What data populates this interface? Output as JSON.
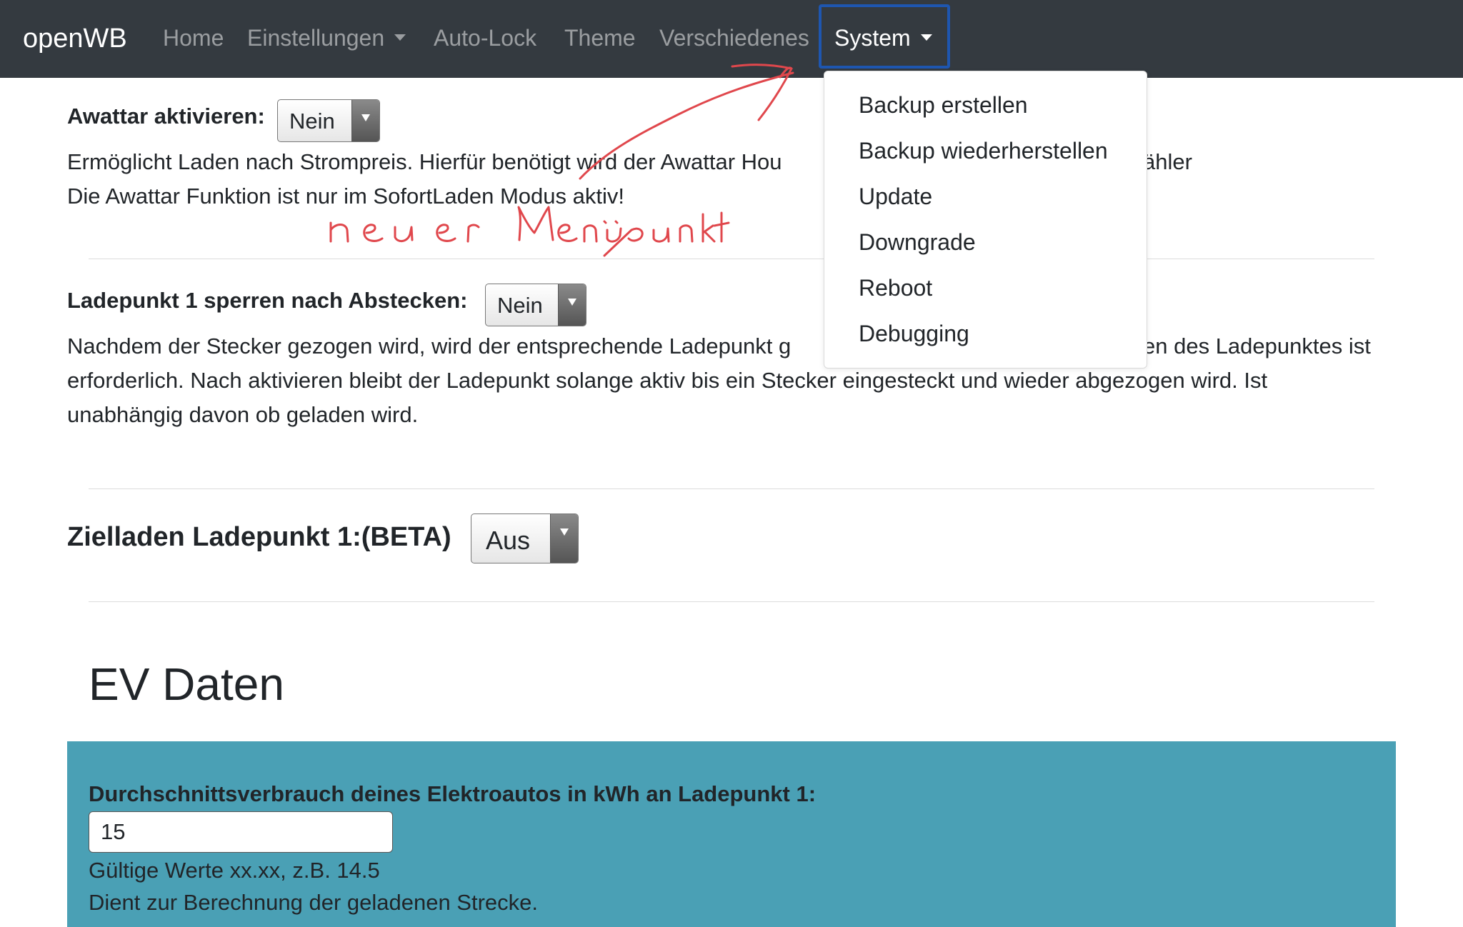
{
  "navbar": {
    "brand": "openWB",
    "items": [
      "Home",
      "Einstellungen",
      "Auto-Lock",
      "Theme",
      "Verschiedenes",
      "System"
    ]
  },
  "system_menu": {
    "items": [
      "Backup erstellen",
      "Backup wiederherstellen",
      "Update",
      "Downgrade",
      "Reboot",
      "Debugging"
    ]
  },
  "awattar": {
    "label": "Awattar aktivieren:",
    "value": "Nein",
    "desc_line1_a": "Ermöglicht Laden nach Strompreis. Hierfür benötigt wird der Awattar Hou",
    "desc_line1_b": "ähler",
    "desc_line2": "Die Awattar Funktion ist nur im SofortLaden Modus aktiv!"
  },
  "lock": {
    "label": "Ladepunkt 1 sperren nach Abstecken:",
    "value": "Nein",
    "desc_line1_a": "Nachdem der Stecker gezogen wird, wird der entsprechende Ladepunkt g",
    "desc_line1_b": "en des Ladepunktes ist",
    "desc_line2": "erforderlich. Nach aktivieren bleibt der Ladepunkt solange aktiv bis ein Stecker eingesteckt und wieder abgezogen wird. Ist",
    "desc_line3": "unabhängig davon ob geladen wird."
  },
  "zielladen": {
    "label": "Zielladen Ladepunkt 1:(BETA)",
    "value": "Aus"
  },
  "ev_daten": {
    "heading": "EV Daten",
    "label": "Durchschnittsverbrauch deines Elektroautos in kWh an Ladepunkt 1:",
    "value": "15",
    "hint1": "Gültige Werte xx.xx, z.B. 14.5",
    "hint2": "Dient zur Berechnung der geladenen Strecke."
  },
  "colors": {
    "navbar": "#343a40",
    "highlight": "#1e56b0",
    "card": "#4aa0b5",
    "annotation": "#e0474c"
  },
  "annotation_handwriting": "neuer Menüpunkt"
}
